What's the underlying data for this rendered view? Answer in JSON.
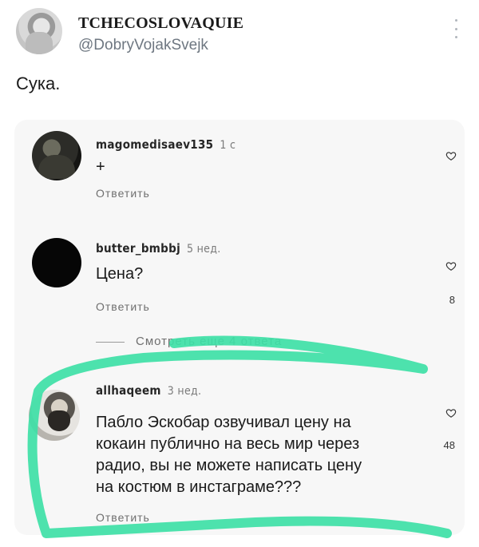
{
  "tweet": {
    "display_name": "TCHECOSLOVAQUIE",
    "handle": "@DobryVojakSvejk",
    "text": "Сука."
  },
  "embedded": {
    "comments": [
      {
        "username": "magomedisaev135",
        "time": "1 с",
        "text": "+",
        "reply_label": "Ответить",
        "likes": ""
      },
      {
        "username": "butter_bmbbj",
        "time": "5 нед.",
        "text": "Цена?",
        "reply_label": "Ответить",
        "likes": "8"
      },
      {
        "username": "allhaqeem",
        "time": "3 нед.",
        "text_lines": [
          "Пабло Эскобар озвучивал цену на",
          "кокаин публично на весь мир через",
          "радио, вы не можете написать цену",
          "на костюм в инстаграме???"
        ],
        "reply_label": "Ответить",
        "likes": "48"
      }
    ],
    "view_replies_label": "Смотреть еще 4 ответа"
  },
  "colors": {
    "highlighter": "#3ee0a6",
    "handle": "#6e7781"
  },
  "icons": [
    "more-vertical-icon",
    "heart-icon"
  ]
}
